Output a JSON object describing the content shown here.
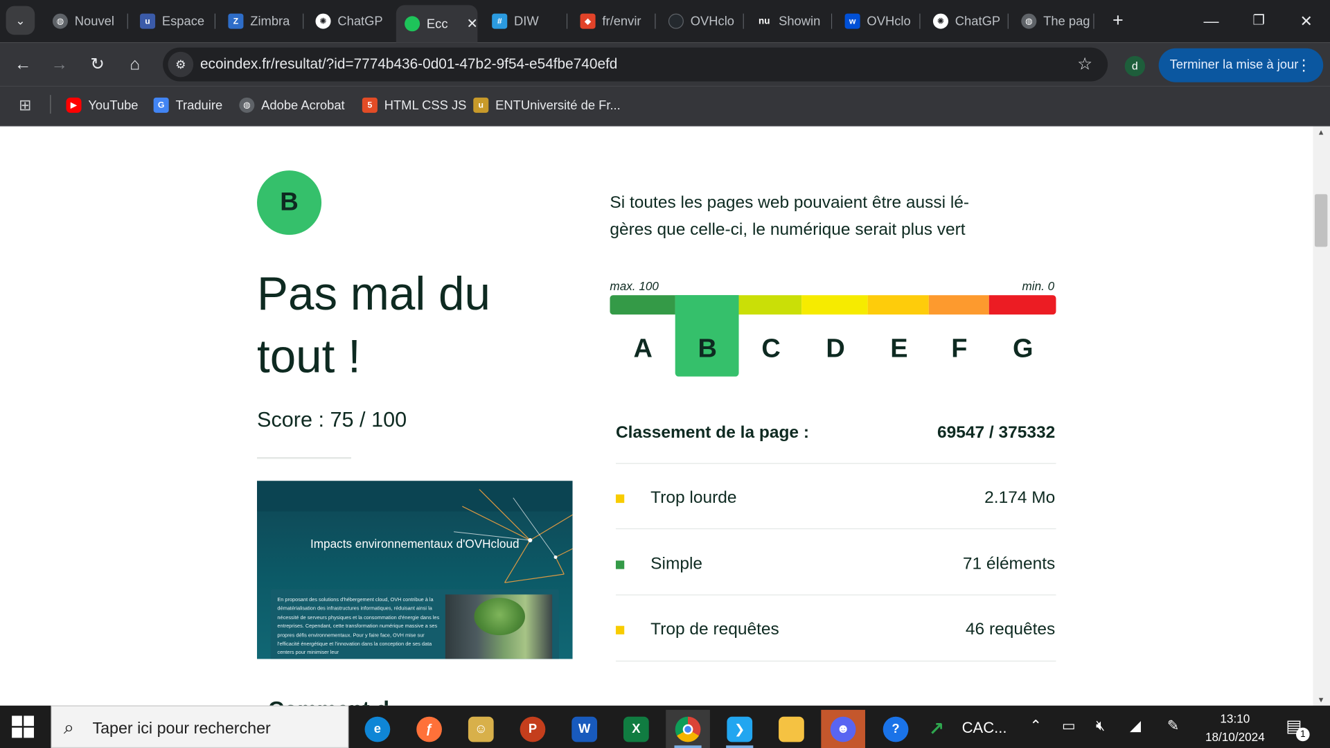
{
  "browser": {
    "tabs": [
      {
        "label": "Nouvel",
        "icon": "globe-icon",
        "color": "#5f6368"
      },
      {
        "label": "Espace",
        "icon": "u-logo-icon",
        "color": "#3b5ba9"
      },
      {
        "label": "Zimbra",
        "icon": "zimbra-icon",
        "color": "#2e6dc8"
      },
      {
        "label": "ChatGP",
        "icon": "openai-icon",
        "color": "#ffffff"
      },
      {
        "label": "Ecc",
        "icon": "ecoindex-icon",
        "color": "#1ec45a"
      },
      {
        "label": "DIW",
        "icon": "hashtag-icon",
        "color": "#2b9be0"
      },
      {
        "label": "fr/envir",
        "icon": "gitlab-icon",
        "color": "#e24329"
      },
      {
        "label": "OVHclo",
        "icon": "github-icon",
        "color": "#24292e"
      },
      {
        "label": "Showin",
        "icon": "nu-icon",
        "color": "#202124"
      },
      {
        "label": "OVHclo",
        "icon": "ovh-icon",
        "color": "#0050d7"
      },
      {
        "label": "ChatGP",
        "icon": "openai-icon",
        "color": "#ffffff"
      },
      {
        "label": "The pag",
        "icon": "globe-icon",
        "color": "#5f6368"
      }
    ],
    "active_tab_index": 4,
    "url": "ecoindex.fr/resultat/?id=7774b436-0d01-47b2-9f54-e54fbe740efd",
    "profile_initial": "d",
    "update_button": "Terminer la mise à jour",
    "bookmarks": [
      {
        "label": "YouTube",
        "icon": "youtube-icon",
        "color": "#ff0000"
      },
      {
        "label": "Traduire",
        "icon": "google-translate-icon",
        "color": "#4285f4"
      },
      {
        "label": "Adobe Acrobat",
        "icon": "globe-icon",
        "color": "#5f6368"
      },
      {
        "label": "HTML CSS JS",
        "icon": "html5-icon",
        "color": "#e34c26"
      },
      {
        "label": "ENTUniversité de Fr...",
        "icon": "u-logo-icon",
        "color": "#c89a2a"
      }
    ]
  },
  "page": {
    "grade": "B",
    "heading": "Pas mal du tout !",
    "score_text": "Score : 75 / 100",
    "score_value": 75,
    "score_max": 100,
    "tagline": "Si toutes les pages web pouvaient être aussi lé-gères que celle-ci, le numérique serait plus vert",
    "scale": {
      "max_label": "max. 100",
      "min_label": "min. 0",
      "grades": [
        "A",
        "B",
        "C",
        "D",
        "E",
        "F",
        "G"
      ],
      "colors": [
        "#349a47",
        "#35c06b",
        "#cadf07",
        "#f6eb00",
        "#fecc0b",
        "#fd9a2e",
        "#ec1c23"
      ],
      "selected": "B"
    },
    "ranking_label": "Classement de la page :",
    "ranking_value": "69547 / 375332",
    "metrics": [
      {
        "label": "Trop lourde",
        "value": "2.174 Mo",
        "color": "#f8cc00"
      },
      {
        "label": "Simple",
        "value": "71 éléments",
        "color": "#349a47"
      },
      {
        "label": "Trop de requêtes",
        "value": "46 requêtes",
        "color": "#f8cc00"
      }
    ],
    "preview": {
      "title": "Impacts environnementaux d'OVHcloud",
      "body": "En proposant des solutions d'hébergement cloud, OVH contribue à la dématérialisation des infrastructures informatiques, réduisant ainsi la nécessité de serveurs physiques et la consommation d'énergie dans les entreprises. Cependant, cette transformation numérique massive a ses propres défis environnementaux. Pour y faire face, OVH mise sur l'efficacité énergétique et l'innovation dans la conception de ses data centers pour minimiser leur"
    },
    "cut_heading": "Comment d"
  },
  "taskbar": {
    "search_placeholder": "Taper ici pour rechercher",
    "apps": [
      {
        "name": "edge-icon",
        "color": "#0f86d6"
      },
      {
        "name": "firefox-icon",
        "color": "#ff7139"
      },
      {
        "name": "file-explorer-user-icon",
        "color": "#d8b04a"
      },
      {
        "name": "powerpoint-icon",
        "color": "#c43e1c",
        "glyph": "P"
      },
      {
        "name": "word-icon",
        "color": "#185abd",
        "glyph": "W"
      },
      {
        "name": "excel-icon",
        "color": "#107c41",
        "glyph": "X"
      },
      {
        "name": "chrome-icon",
        "color": "#4285f4"
      },
      {
        "name": "vscode-icon",
        "color": "#22a6f0"
      },
      {
        "name": "file-explorer-icon",
        "color": "#f5c242"
      },
      {
        "name": "discord-icon",
        "color": "#5865f2"
      },
      {
        "name": "help-icon",
        "color": "#1a73e8",
        "glyph": "?"
      },
      {
        "name": "stocks-icon",
        "color": "#2fa84f"
      }
    ],
    "stock_label": "CAC...",
    "time": "13:10",
    "date": "18/10/2024",
    "notification_count": "1"
  }
}
